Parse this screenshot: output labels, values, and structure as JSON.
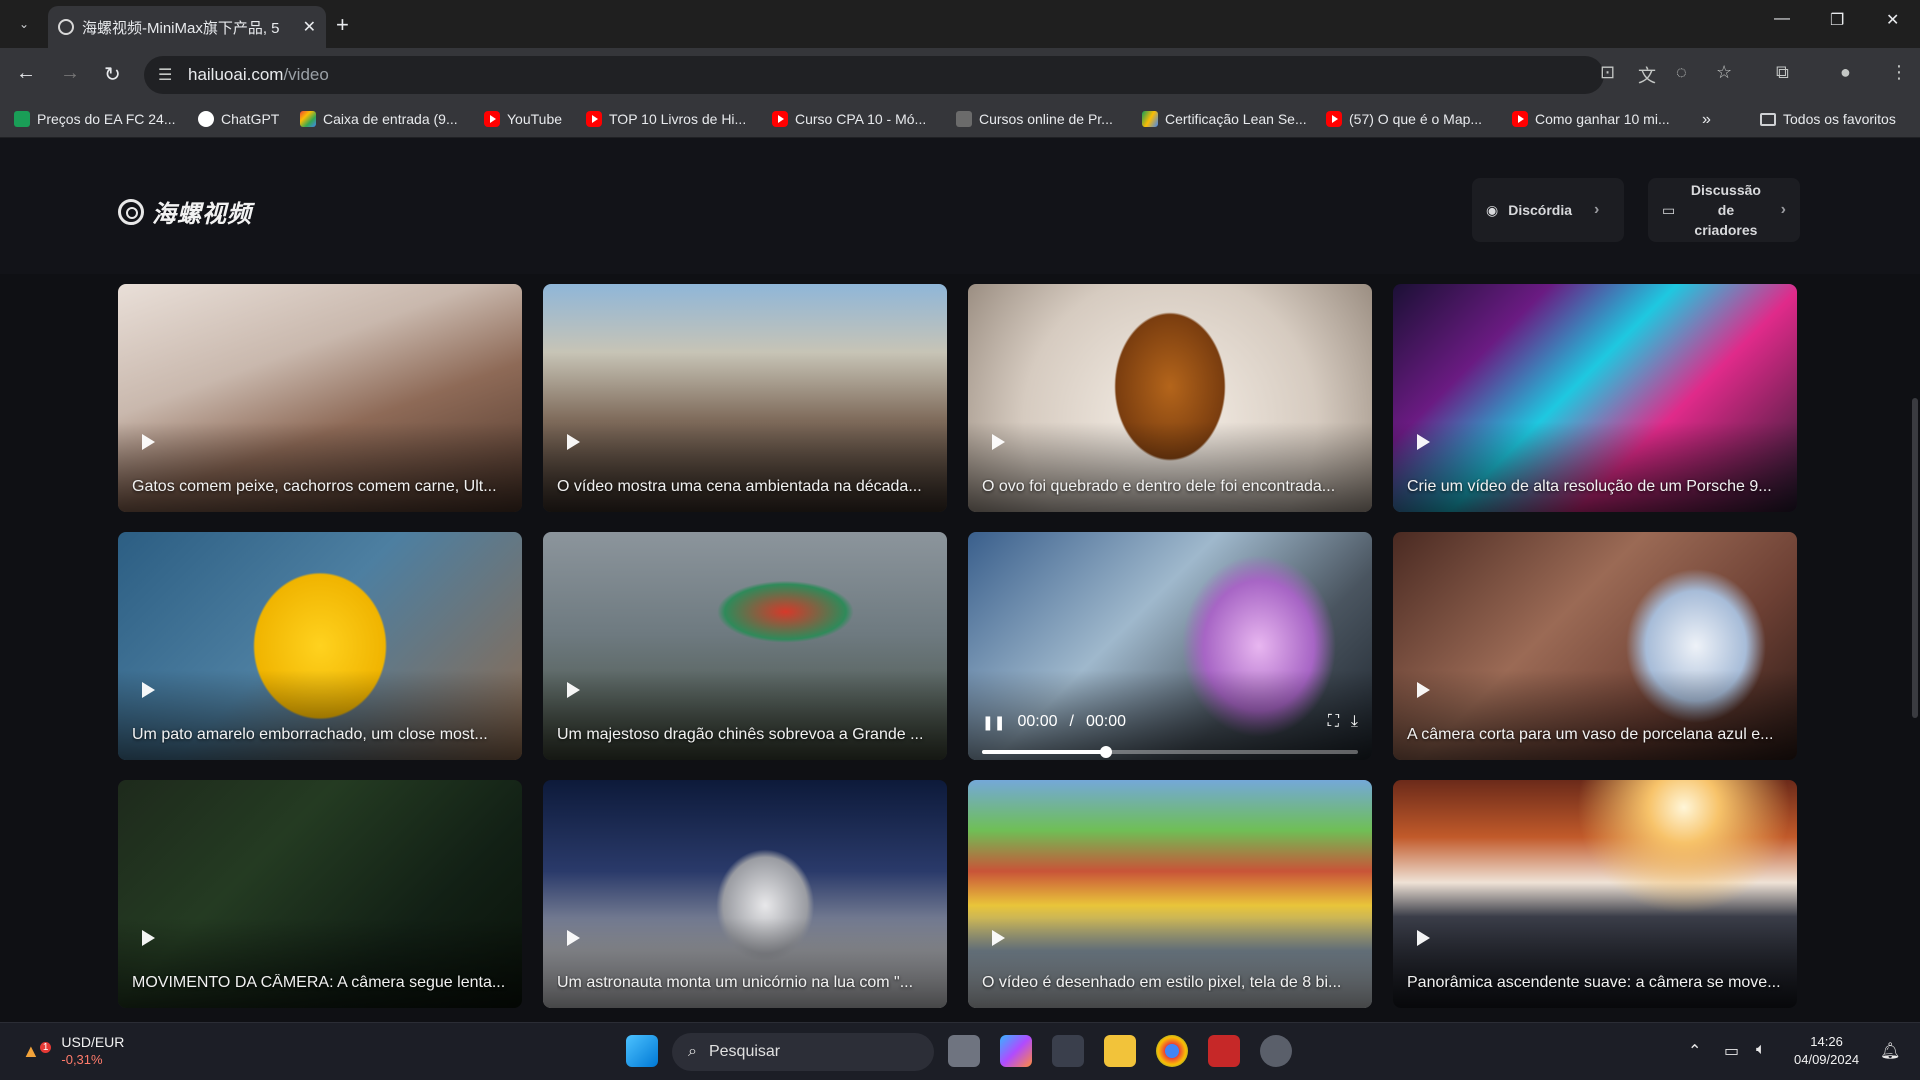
{
  "browser": {
    "tab_title": "海螺视频-MiniMax旗下产品, 5",
    "url_host": "hailuoai.com",
    "url_path": "/video",
    "bookmarks": [
      {
        "label": "Preços do EA FC 24...",
        "icon": "green-square-icon"
      },
      {
        "label": "ChatGPT",
        "icon": "chatgpt-icon"
      },
      {
        "label": "Caixa de entrada (9...",
        "icon": "gmail-icon"
      },
      {
        "label": "YouTube",
        "icon": "youtube-icon"
      },
      {
        "label": "TOP 10 Livros de Hi...",
        "icon": "youtube-icon"
      },
      {
        "label": "Curso CPA 10 - Mó...",
        "icon": "youtube-icon"
      },
      {
        "label": "Cursos online de Pr...",
        "icon": "course-icon"
      },
      {
        "label": "Certificação Lean Se...",
        "icon": "drive-icon"
      },
      {
        "label": "(57) O que é o Map...",
        "icon": "youtube-icon"
      },
      {
        "label": "Como ganhar 10 mi...",
        "icon": "youtube-icon"
      }
    ],
    "more_bookmarks": "»",
    "all_favorites": "Todos os favoritos"
  },
  "site": {
    "logo_text": "海螺视频",
    "discord_label": "Discórdia",
    "creators_label_line1": "Discussão de",
    "creators_label_line2": "criadores"
  },
  "videos": [
    {
      "caption": "Gatos comem peixe, cachorros comem carne, Ult...",
      "scene": "cats"
    },
    {
      "caption": "O vídeo mostra uma cena ambientada na década...",
      "scene": "street"
    },
    {
      "caption": "O ovo foi quebrado e dentro dele foi encontrada...",
      "scene": "egg"
    },
    {
      "caption": "Crie um vídeo de alta resolução de um Porsche 9...",
      "scene": "neon"
    },
    {
      "caption": "Um pato amarelo emborrachado, um close most...",
      "scene": "duck"
    },
    {
      "caption": "Um majestoso dragão chinês sobrevoa a Grande ...",
      "scene": "dragon"
    },
    {
      "caption": "",
      "scene": "lab",
      "playing": true,
      "time_current": "00:00",
      "time_sep": "/",
      "time_total": "00:00",
      "progress": 0.33
    },
    {
      "caption": "A câmera corta para um vaso de porcelana azul e...",
      "scene": "vase"
    },
    {
      "caption": "MOVIMENTO DA CÂMERA: A câmera segue lenta...",
      "scene": "forest"
    },
    {
      "caption": "Um astronauta monta um unicórnio na lua com \"...",
      "scene": "moon"
    },
    {
      "caption": "O vídeo é desenhado em estilo pixel, tela de 8 bi...",
      "scene": "pixel"
    },
    {
      "caption": "Panorâmica ascendente suave: a câmera se move...",
      "scene": "planet"
    }
  ],
  "taskbar": {
    "stock_name": "USD/EUR",
    "stock_change": "-0,31%",
    "stock_badge": "1",
    "search_placeholder": "Pesquisar",
    "time": "14:26",
    "date": "04/09/2024"
  }
}
